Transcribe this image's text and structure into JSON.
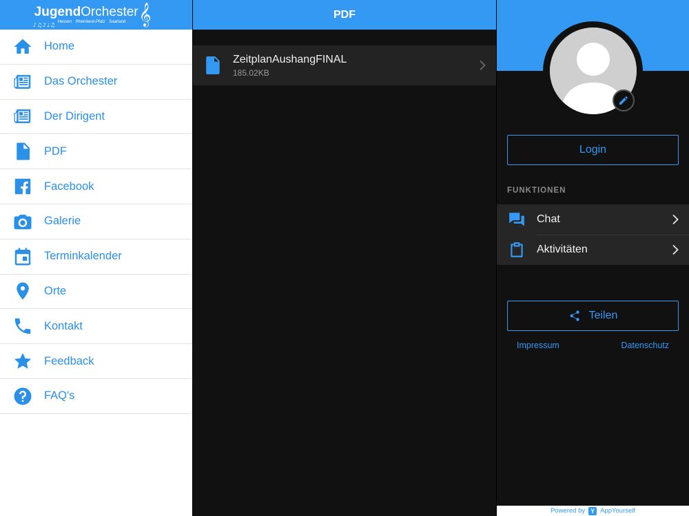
{
  "brand": {
    "logo_bold": "Jugend",
    "logo_regular": "Orchester",
    "regions": [
      "Hessen",
      "Rheinland-Pfalz",
      "Saarland"
    ]
  },
  "sidebar": {
    "items": [
      {
        "label": "Home",
        "icon": "home-icon"
      },
      {
        "label": "Das Orchester",
        "icon": "newspaper-icon"
      },
      {
        "label": "Der Dirigent",
        "icon": "newspaper-icon"
      },
      {
        "label": "PDF",
        "icon": "file-icon"
      },
      {
        "label": "Facebook",
        "icon": "facebook-icon"
      },
      {
        "label": "Galerie",
        "icon": "camera-icon"
      },
      {
        "label": "Terminkalender",
        "icon": "calendar-icon"
      },
      {
        "label": "Orte",
        "icon": "map-pin-icon"
      },
      {
        "label": "Kontakt",
        "icon": "phone-icon"
      },
      {
        "label": "Feedback",
        "icon": "star-icon"
      },
      {
        "label": "FAQ's",
        "icon": "question-icon"
      }
    ]
  },
  "main": {
    "title": "PDF",
    "files": [
      {
        "name": "ZeitplanAushangFINAL",
        "size": "185.02KB"
      }
    ]
  },
  "profile": {
    "login_label": "Login",
    "section_label": "FUNKTIONEN",
    "functions": [
      {
        "label": "Chat",
        "icon": "chat-icon"
      },
      {
        "label": "Aktivitäten",
        "icon": "clipboard-icon"
      }
    ],
    "share_label": "Teilen",
    "links": {
      "impressum": "Impressum",
      "datenschutz": "Datenschutz"
    },
    "powered_by": "Powered by",
    "powered_brand": "AppYourself"
  },
  "colors": {
    "accent": "#3399f3",
    "sidebar_text": "#2a90e8",
    "panel_bg": "#111111",
    "row_bg": "#232323"
  }
}
